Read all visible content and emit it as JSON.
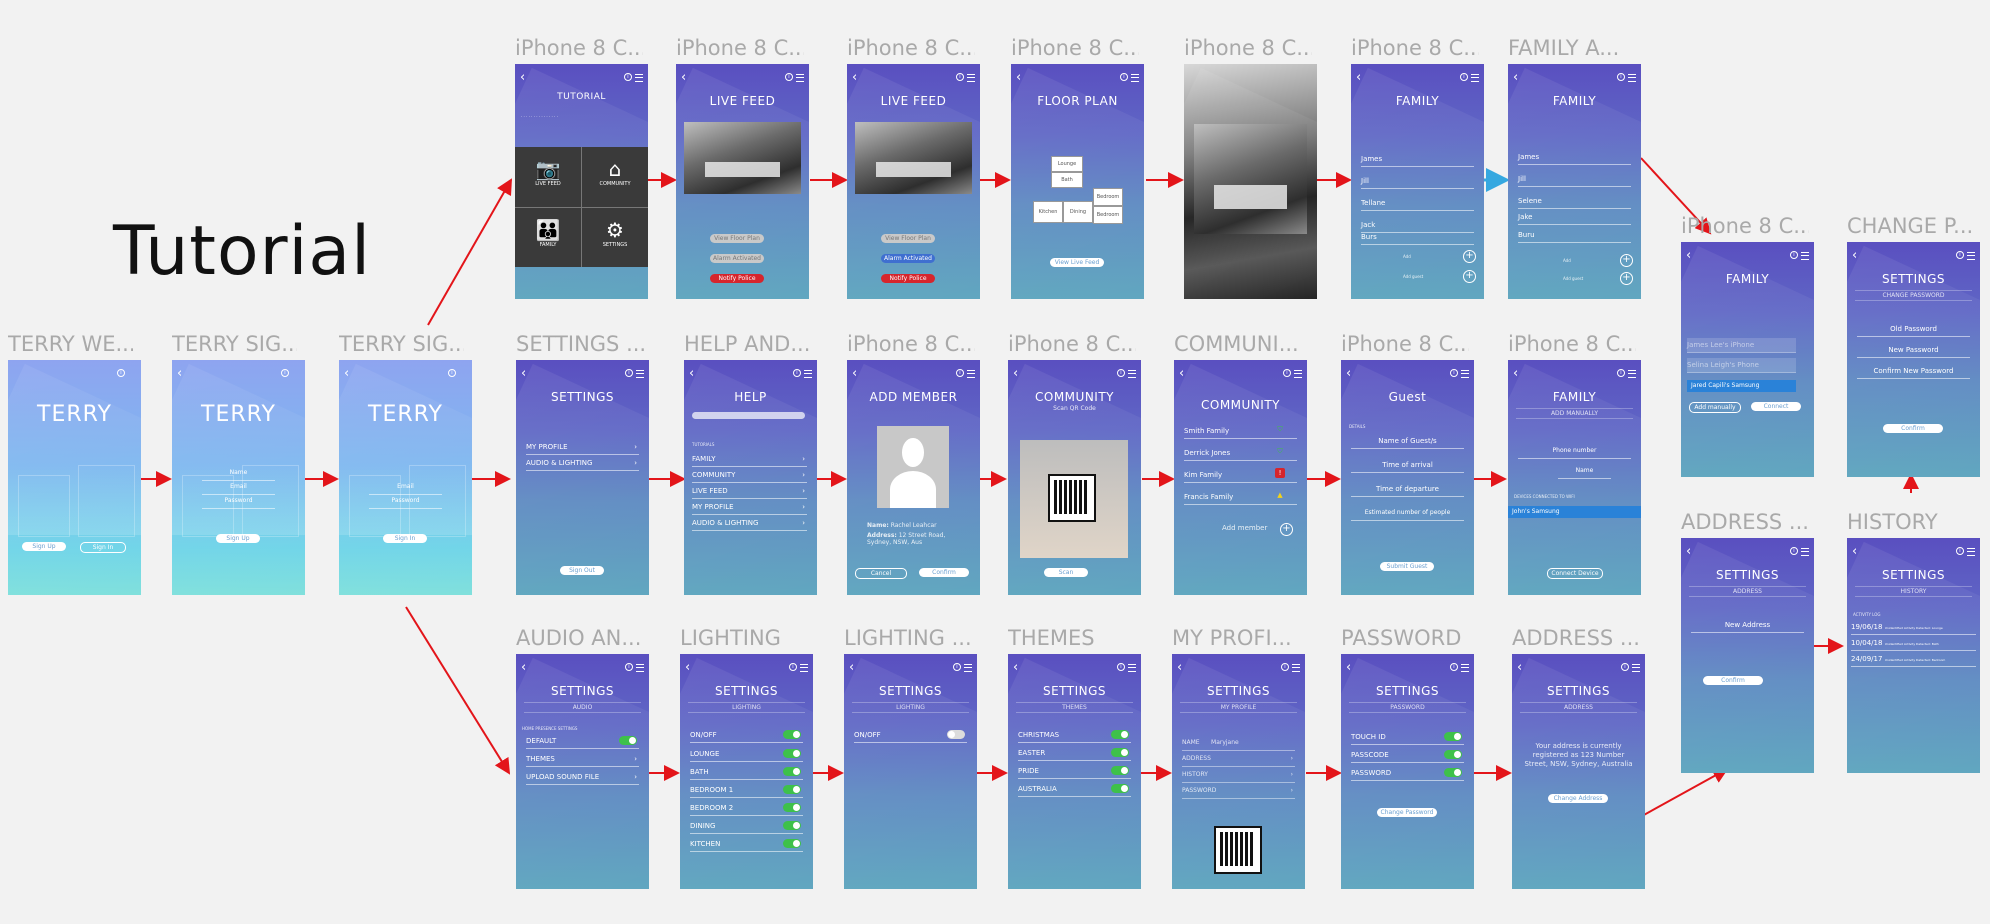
{
  "heading": "Tutorial",
  "colors": {
    "arrow": "#e3151a",
    "connector_blue": "#35a8e0",
    "toggle_on": "#3ec14a",
    "alert_red": "#d6252d",
    "title_grey": "#a9a9a9",
    "highlight": "#2a82d8"
  },
  "frames": {
    "welcome": {
      "title": "TERRY WE...",
      "logo": "TERRY",
      "btn1": "Sign Up",
      "btn2": "Sign In"
    },
    "signup": {
      "title": "TERRY SIG...",
      "logo": "TERRY",
      "f1": "Name",
      "f2": "Email",
      "f3": "Password",
      "btn": "Sign Up"
    },
    "signin": {
      "title": "TERRY SIG...",
      "logo": "TERRY",
      "f1": "Email",
      "f2": "Password",
      "btn": "Sign In"
    },
    "tutorial": {
      "title": "iPhone 8 C...",
      "heading": "TUTORIAL",
      "tiles": [
        "LIVE FEED",
        "COMMUNITY",
        "FAMILY",
        "SETTINGS"
      ]
    },
    "livefeed1": {
      "title": "iPhone 8 C...",
      "heading": "LIVE FEED",
      "btn1": "View Floor Plan",
      "btn2": "Alarm Activated",
      "btn3": "Notify Police"
    },
    "livefeed2": {
      "title": "iPhone 8 C...",
      "heading": "LIVE FEED",
      "btn1": "View Floor Plan",
      "btn2": "Alarm Activated",
      "btn3": "Notify Police"
    },
    "floorplan": {
      "title": "iPhone 8 C...",
      "heading": "FLOOR PLAN",
      "rooms": [
        "Lounge",
        "Bath",
        "Kitchen",
        "Dining",
        "Bedroom",
        "Bedroom"
      ],
      "btn": "View Live Feed"
    },
    "camera": {
      "title": "iPhone 8 C..."
    },
    "family1": {
      "title": "iPhone 8 C...",
      "heading": "FAMILY",
      "members": [
        "James",
        "Jill",
        "Tellane",
        "Jack",
        "Burs"
      ],
      "add1": "Add",
      "add2": "Add guest"
    },
    "family2": {
      "title": "FAMILY A...",
      "heading": "FAMILY",
      "members": [
        "James",
        "Jill",
        "Selene",
        "Jake",
        "Buru"
      ],
      "add1": "Add",
      "add2": "Add guest"
    },
    "family3": {
      "title": "iPhone 8 C...",
      "heading": "FAMILY",
      "devices": [
        "James Lee's iPhone",
        "Selina Leigh's Phone",
        "Jared Capili's Samsung"
      ],
      "btn1": "Add manually",
      "btn2": "Connect"
    },
    "change_password": {
      "title": "CHANGE P...",
      "heading": "SETTINGS",
      "sub": "CHANGE PASSWORD",
      "f1": "Old Password",
      "f2": "New Password",
      "f3": "Confirm New Password",
      "btn": "Confirm"
    },
    "settings": {
      "title": "SETTINGS ...",
      "heading": "SETTINGS",
      "items": [
        "MY PROFILE",
        "AUDIO & LIGHTING"
      ],
      "btn": "Sign Out"
    },
    "help": {
      "title": "HELP AND...",
      "heading": "HELP",
      "section": "TUTORIALS",
      "items": [
        "FAMILY",
        "COMMUNITY",
        "LIVE FEED",
        "MY PROFILE",
        "AUDIO & LIGHTING"
      ]
    },
    "add_member": {
      "title": "iPhone 8 C...",
      "heading": "ADD MEMBER",
      "name_label": "Name:",
      "name_value": "Rachel Leahcar",
      "addr_label": "Address:",
      "addr_value": "12 Street Road, Sydney, NSW, Aus",
      "btn1": "Cancel",
      "btn2": "Confirm"
    },
    "community_scan": {
      "title": "iPhone 8 C...",
      "heading": "COMMUNITY",
      "sub": "Scan QR Code",
      "btn": "Scan"
    },
    "community": {
      "title": "COMMUNI...",
      "heading": "COMMUNITY",
      "items": [
        "Smith Family",
        "Derrick Jones",
        "Kim Family",
        "Francis Family"
      ],
      "add": "Add member"
    },
    "guest": {
      "title": "iPhone 8 C...",
      "heading": "Guest",
      "section": "DETAILS",
      "fields": [
        "Name of Guest/s",
        "Time of arrival",
        "Time of departure",
        "Estimated number of people"
      ],
      "btn": "Submit Guest"
    },
    "family_manual": {
      "title": "iPhone 8 C...",
      "heading": "FAMILY",
      "sub": "ADD MANUALLY",
      "f1": "Phone number",
      "f2": "Name",
      "section": "DEVICES CONNECTED TO WIFI",
      "selected": "John's Samsung",
      "btn": "Connect Device"
    },
    "address_confirm": {
      "title": "ADDRESS ...",
      "heading": "SETTINGS",
      "sub": "ADDRESS",
      "field": "New Address",
      "btn": "Confirm"
    },
    "history": {
      "title": "HISTORY",
      "heading": "SETTINGS",
      "sub": "HISTORY",
      "section": "ACTIVITY LOG",
      "entries": [
        {
          "date": "19/06/18",
          "text": "Unidentified Activity Detected: Lounge"
        },
        {
          "date": "10/04/18",
          "text": "Unidentified Activity Detected: Bath"
        },
        {
          "date": "24/09/17",
          "text": "Unidentified Activity Detected: Bedroom"
        }
      ]
    },
    "audio": {
      "title": "AUDIO AN...",
      "heading": "SETTINGS",
      "sub": "AUDIO",
      "section": "HOME PRESENCE SETTINGS",
      "items": [
        "DEFAULT",
        "THEMES",
        "UPLOAD SOUND FILE"
      ]
    },
    "lighting1": {
      "title": "LIGHTING",
      "heading": "SETTINGS",
      "sub": "LIGHTING",
      "items": [
        "ON/OFF",
        "LOUNGE",
        "BATH",
        "BEDROOM 1",
        "BEDROOM 2",
        "DINING",
        "KITCHEN"
      ]
    },
    "lighting2": {
      "title": "LIGHTING ...",
      "heading": "SETTINGS",
      "sub": "LIGHTING",
      "items": [
        "ON/OFF"
      ]
    },
    "themes": {
      "title": "THEMES",
      "heading": "SETTINGS",
      "sub": "THEMES",
      "items": [
        "CHRISTMAS",
        "EASTER",
        "PRIDE",
        "AUSTRALIA"
      ]
    },
    "my_profile": {
      "title": "MY PROFI...",
      "heading": "SETTINGS",
      "sub": "MY PROFILE",
      "name_label": "NAME",
      "name_value": "Maryjane",
      "items": [
        "ADDRESS",
        "HISTORY",
        "PASSWORD"
      ]
    },
    "password": {
      "title": "PASSWORD",
      "heading": "SETTINGS",
      "sub": "PASSWORD",
      "items": [
        "TOUCH ID",
        "PASSCODE",
        "PASSWORD"
      ],
      "btn": "Change Password"
    },
    "address": {
      "title": "ADDRESS ...",
      "heading": "SETTINGS",
      "sub": "ADDRESS",
      "text": "Your address is currently registered as 123 Number Street, NSW, Sydney, Australia",
      "btn": "Change Address"
    }
  }
}
